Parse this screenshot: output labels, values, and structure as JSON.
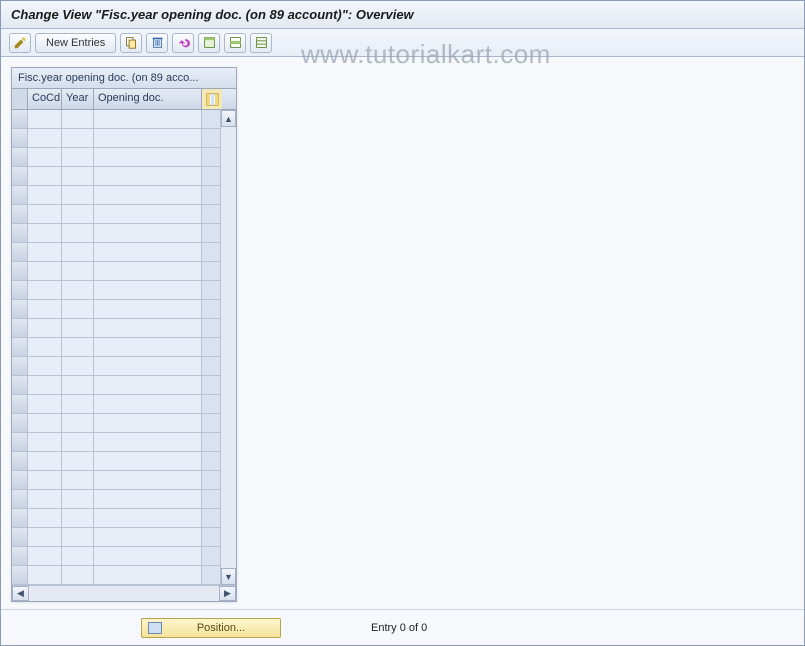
{
  "header": {
    "title": "Change View \"Fisc.year opening doc. (on 89 account)\": Overview"
  },
  "toolbar": {
    "new_entries_label": "New Entries",
    "icons": {
      "edit": "edit-toggle",
      "copy": "copy",
      "delete": "delete",
      "undo": "undo",
      "select_all": "select-all",
      "select_block": "select-block",
      "deselect_all": "deselect-all"
    }
  },
  "watermark": "www.tutorialkart.com",
  "table": {
    "title": "Fisc.year opening doc. (on 89 acco...",
    "columns": {
      "cocd": "CoCd",
      "year": "Year",
      "opening_doc": "Opening doc."
    },
    "row_count": 25,
    "config_icon": "configure-columns"
  },
  "footer": {
    "position_label": "Position...",
    "entry_info": "Entry 0 of 0"
  }
}
